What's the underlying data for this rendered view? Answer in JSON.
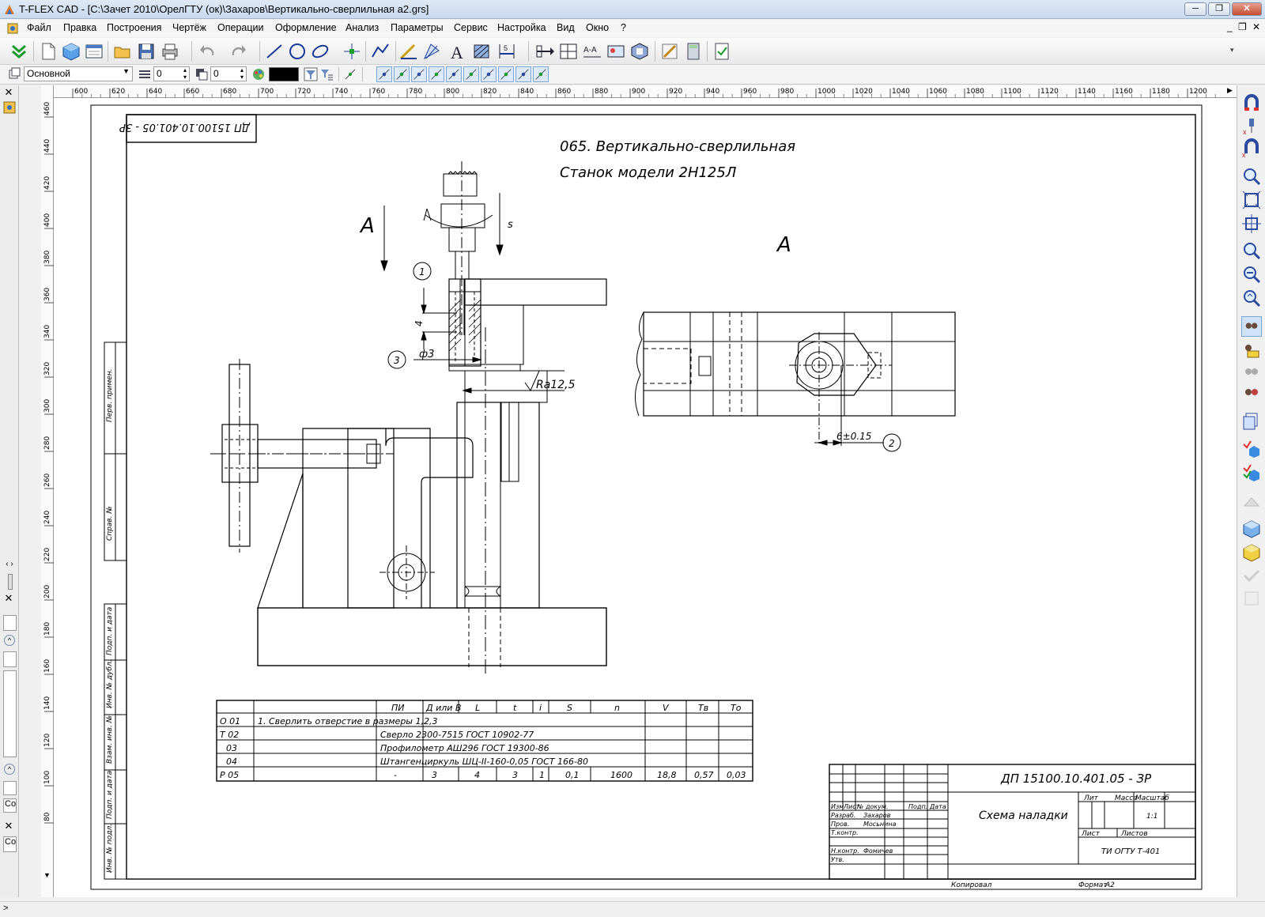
{
  "window": {
    "title": "T-FLEX CAD - [C:\\Зачет 2010\\ОрелГТУ (ок)\\Захаров\\Вертикально-сверлильная а2.grs]",
    "btn_min": "─",
    "btn_max": "❐",
    "btn_close": "✕"
  },
  "menu": {
    "items": [
      "Файл",
      "Правка",
      "Построения",
      "Чертёж",
      "Операции",
      "Оформление",
      "Анализ",
      "Параметры",
      "Сервис",
      "Настройка",
      "Вид",
      "Окно",
      "?"
    ],
    "mdi_min": "_",
    "mdi_restore": "❐",
    "mdi_close": "✕"
  },
  "toolbar2": {
    "layer_combo": "Основной",
    "level_value": "0",
    "priority_value": "0",
    "color_swatch": "#000000"
  },
  "rulers": {
    "h_ticks": [
      "600",
      "620",
      "640",
      "660",
      "680",
      "700",
      "720",
      "740",
      "760",
      "780",
      "800",
      "820",
      "840",
      "860",
      "880",
      "900",
      "920",
      "940",
      "960",
      "980",
      "1000",
      "1020",
      "1040",
      "1060",
      "1080",
      "1100",
      "1120",
      "1140",
      "1160",
      "1180",
      "1200"
    ],
    "v_ticks": [
      "460",
      "440",
      "420",
      "400",
      "380",
      "360",
      "340",
      "320",
      "300",
      "280",
      "260",
      "240",
      "220",
      "200",
      "180",
      "160",
      "140",
      "120",
      "100",
      "80"
    ]
  },
  "left_panel": {
    "close1": "✕",
    "close2": "✕",
    "close3": "✕",
    "field1": "Cox",
    "field2": "Co"
  },
  "drawing": {
    "stamp_mirrored": "ДП 15100.10.401.05 - ЗР",
    "op_title": "065. Вертикально-сверлильная",
    "machine": "Станок модели 2Н125Л",
    "view_label_left": "А",
    "view_label_right": "А",
    "feed_label": "s",
    "dim_4": "4",
    "dim_phi3": "ф3",
    "roughness": "Ra12,5",
    "callout_1": "1",
    "callout_2": "2",
    "callout_3": "3",
    "dim_6": "6±0.15",
    "side_labels": [
      "Перв. примен.",
      "Справ. №",
      "Подп. и дата",
      "Инв. № дубл.",
      "Взам. инв. №",
      "Подп. и дата",
      "Инв. № подл."
    ]
  },
  "op_table": {
    "headers": [
      "ПИ",
      "Д или В",
      "L",
      "t",
      "i",
      "S",
      "n",
      "V",
      "Тв",
      "То"
    ],
    "rows": [
      [
        "О 01",
        "1. Сверлить отверстие в размеры 1,2,3",
        "",
        "",
        "",
        "",
        "",
        "",
        "",
        "",
        ""
      ],
      [
        "Т 02",
        "",
        "Сверло 2300-7515 ГОСТ 10902-77",
        "",
        "",
        "",
        "",
        "",
        "",
        "",
        ""
      ],
      [
        "03",
        "",
        "Профилометр АШ296 ГОСТ 19300-86",
        "",
        "",
        "",
        "",
        "",
        "",
        "",
        ""
      ],
      [
        "04",
        "",
        "Штангенциркуль ШЦ-II-160-0,05 ГОСТ 166-80",
        "",
        "",
        "",
        "",
        "",
        "",
        "",
        ""
      ],
      [
        "Р 05",
        "",
        "-",
        "3",
        "4",
        "3",
        "1",
        "0,1",
        "1600",
        "18,8",
        "0,57",
        "0,03"
      ]
    ]
  },
  "title_block": {
    "code": "ДП 15100.10.401.05 - ЗР",
    "name": "Схема наладки",
    "lit": "Лит",
    "massa": "Масса",
    "masshtab": "Масштаб",
    "scale_value": "1:1",
    "list": "Лист",
    "listov": "Листов",
    "org": "ТИ ОГТУ Т-401",
    "izm": "Изм",
    "list_h": "Лист",
    "ndoc": "№ докум.",
    "podp": "Подп.",
    "data": "Дата",
    "razrab": "Разраб.",
    "razrab_name": "Захаров",
    "prov": "Пров.",
    "prov_name": "Мосьнина",
    "tkont": "Т.контр.",
    "nkont": "Н.контр.",
    "nkont_name": "Фомичев",
    "utv": "Утв.",
    "kopiroval": "Копировал",
    "format": "Формат",
    "format_value": "А2"
  }
}
